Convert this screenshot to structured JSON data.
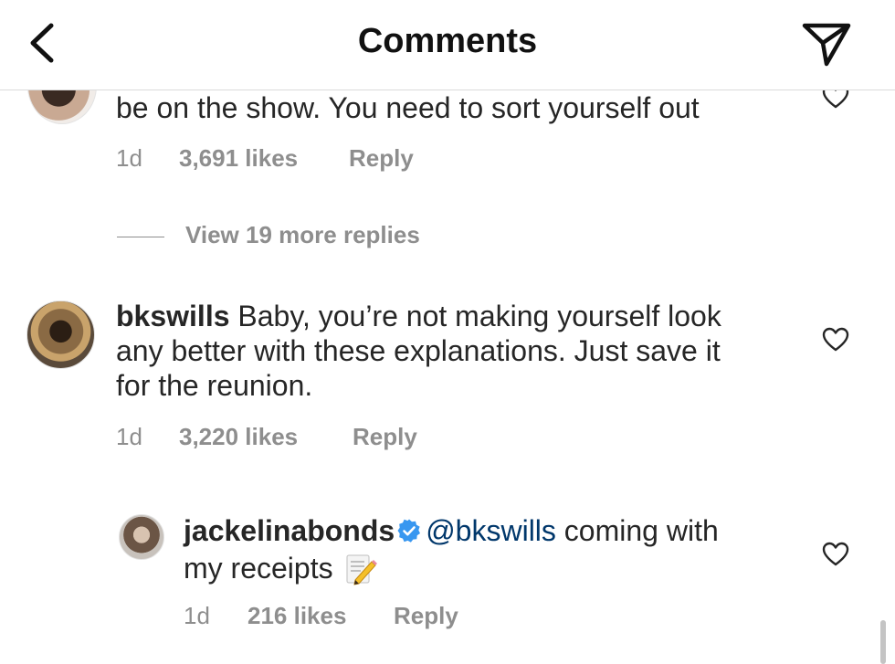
{
  "header": {
    "title": "Comments"
  },
  "comments": [
    {
      "text": "be on the show. You need to sort yourself out",
      "time": "1d",
      "likes": "3,691 likes",
      "reply": "Reply"
    },
    {
      "view_replies": "View 19 more replies"
    },
    {
      "username": "bkswills",
      "text_line1": "Baby, you’re not making yourself look",
      "text_line2": "any better with these explanations. Just save it",
      "text_line3": "for the reunion.",
      "time": "1d",
      "likes": "3,220 likes",
      "reply": "Reply"
    }
  ],
  "reply": {
    "username": "jackelinabonds",
    "mention": "@bkswills",
    "text_line1": "coming with",
    "text_line2": "my receipts",
    "time": "1d",
    "likes": "216 likes",
    "reply": "Reply"
  },
  "colors": {
    "text": "#262626",
    "secondary": "#8e8e8e",
    "mention": "#00376b",
    "verified": "#3897f0"
  },
  "icons": [
    "back-arrow-icon",
    "send-icon",
    "heart-icon",
    "verified-badge-icon",
    "memo-pencil-emoji"
  ]
}
